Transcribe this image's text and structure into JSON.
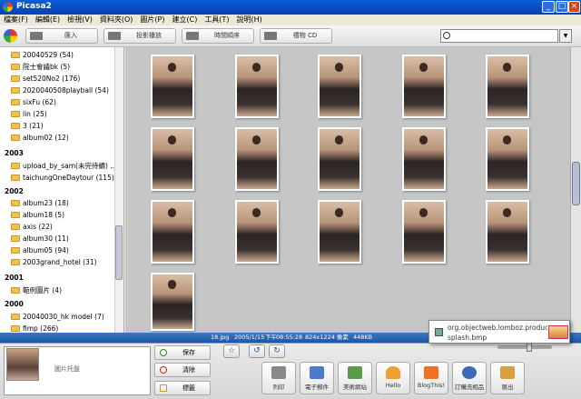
{
  "window": {
    "title": "Picasa2"
  },
  "menu": [
    "檔案(F)",
    "編輯(E)",
    "檢視(V)",
    "資料夾(O)",
    "圖片(P)",
    "建立(C)",
    "工具(T)",
    "說明(H)"
  ],
  "toolbar": {
    "import": "匯入",
    "slideshow": "投影播放",
    "timeline": "時間順序",
    "gift_cd": "禮物 CD",
    "search_placeholder": ""
  },
  "sidebar": {
    "folders_top": [
      "20040529 (54)",
      "院士會議bk (5)",
      "set520No2 (176)",
      "2020040508playball (54)",
      "sixFu (62)",
      "lin (25)",
      "3 (21)",
      "album02 (12)"
    ],
    "year_2003": "2003",
    "folders_2003": [
      "upload_by_sam(未完待續) ...",
      "taichungOneDaytour (115)"
    ],
    "year_2002": "2002",
    "folders_2002": [
      "album23 (18)",
      "album18 (5)",
      "axis (22)",
      "album30 (11)",
      "album05 (94)",
      "2003grand_hotel (31)"
    ],
    "year_2001": "2001",
    "folders_2001": [
      "範例圖片 (4)"
    ],
    "year_2000": "2000",
    "folders_2000": [
      "20040030_hk model (7)",
      "fimp (266)"
    ]
  },
  "status": {
    "filename": "18.jpg",
    "date": "2005/1/15",
    "ampm": "下午",
    "time": "08:55:28",
    "dimensions": "824x1224 像素",
    "size": "448KB"
  },
  "popup": {
    "line1": "org.objectweb.lomboz.product",
    "line2": "splash.bmp"
  },
  "tray": {
    "label": "圖片托盤",
    "save": "保存",
    "clear": "清除",
    "label_btn": "標籤"
  },
  "actions": [
    "列印",
    "電子郵件",
    "美術網站",
    "Hello",
    "BlogThis!",
    "訂購洗相品",
    "匯出"
  ]
}
